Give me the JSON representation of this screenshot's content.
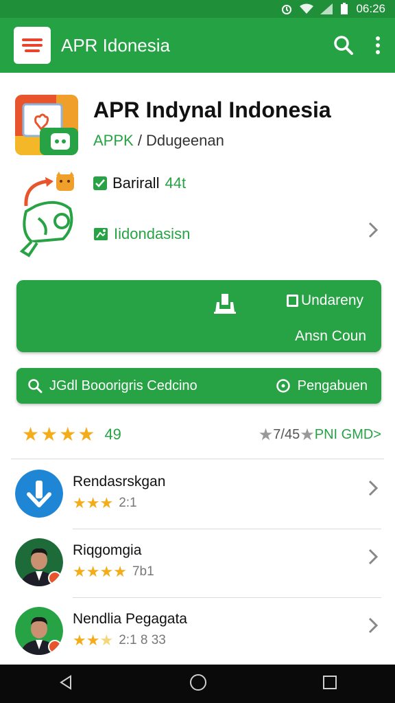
{
  "status_bar": {
    "time": "06:26"
  },
  "app_bar": {
    "title": "APR Idonesia"
  },
  "app": {
    "title": "APR Indynal Indonesia",
    "subtitle_prefix": "APPK",
    "subtitle_rest": " / Ddugeenan"
  },
  "info": {
    "badge_label": "Barirall",
    "badge_value": "44t",
    "location_label": "Iidondasisn"
  },
  "primary_button": {
    "label": "Undareny",
    "sublabel": "Ansn Coun"
  },
  "search_bar": {
    "left_label": "JGdl Booorigris Cedcino",
    "right_label": "Pengabuen"
  },
  "rating": {
    "score": "49",
    "right_text": "7/45",
    "right_link": "PNI GMD>"
  },
  "list": [
    {
      "name": "Rendasrskgan",
      "rating": "2:1",
      "stars": 3
    },
    {
      "name": "Riqgomgia",
      "rating": "7b1",
      "stars": 4
    },
    {
      "name": "Nendlia Pegagata",
      "rating": "2:1 8 33",
      "stars": 3
    }
  ],
  "colors": {
    "brand_green": "#27a244",
    "star": "#f4ad1a",
    "accent_orange": "#e8452c"
  }
}
